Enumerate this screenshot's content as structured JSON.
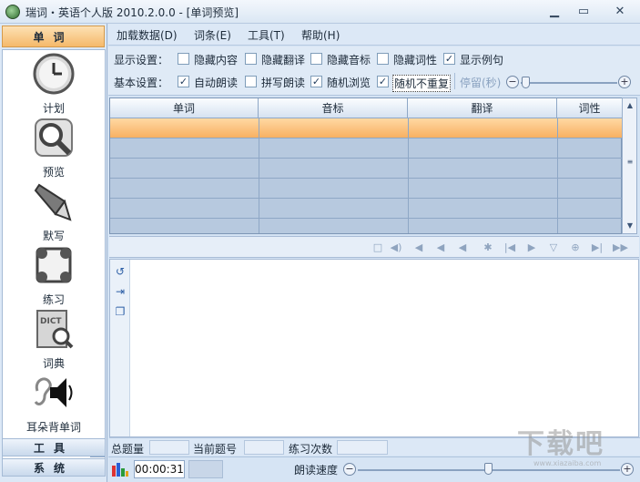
{
  "window": {
    "title": "瑞词・英语个人版 2010.2.0.0 - [单词预览]",
    "minimize": "▁",
    "restore": "▭",
    "close": "✕"
  },
  "sidebar": {
    "header": "单词",
    "items": [
      {
        "label": "计划",
        "icon": "clock-icon"
      },
      {
        "label": "预览",
        "icon": "magnifier-icon"
      },
      {
        "label": "默写",
        "icon": "pen-icon"
      },
      {
        "label": "练习",
        "icon": "exercise-icon"
      },
      {
        "label": "词典",
        "icon": "dictionary-icon"
      },
      {
        "label": "耳朵背单词",
        "icon": "speaker-icon"
      }
    ],
    "scroll_down": "▼",
    "footer_tools": "工具",
    "footer_system": "系统"
  },
  "menubar": [
    "加载数据(D)",
    "词条(E)",
    "工具(T)",
    "帮助(H)"
  ],
  "settings": {
    "display_label": "显示设置：",
    "display_options": [
      {
        "label": "隐藏内容",
        "checked": false
      },
      {
        "label": "隐藏翻译",
        "checked": false
      },
      {
        "label": "隐藏音标",
        "checked": false
      },
      {
        "label": "隐藏词性",
        "checked": false
      },
      {
        "label": "显示例句",
        "checked": true
      }
    ],
    "basic_label": "基本设置：",
    "basic_options": [
      {
        "label": "自动朗读",
        "checked": true
      },
      {
        "label": "拼写朗读",
        "checked": false
      },
      {
        "label": "随机浏览",
        "checked": true
      },
      {
        "label": "随机不重复",
        "checked": true
      }
    ],
    "stay_label": "停留(秒)",
    "minus": "−",
    "plus": "+"
  },
  "grid": {
    "columns": [
      "单词",
      "音标",
      "翻译",
      "词性"
    ],
    "rows": 5,
    "selected_row": 0
  },
  "player_icons": [
    "stop-icon",
    "play-sound-icon",
    "sound-low-icon",
    "sound-mid-icon",
    "sound-high-icon",
    "shuffle-icon",
    "first-icon",
    "play-icon",
    "flag-icon",
    "loop-icon",
    "last-icon",
    "forward-icon"
  ],
  "player_glyphs": [
    "□",
    "◀)",
    "◀",
    "◀",
    "◀",
    "✱",
    "|◀",
    "▶",
    "▽",
    "⊕",
    "▶|",
    "▶▶"
  ],
  "editor_tools": {
    "refresh": "↺",
    "next": "⇥",
    "copy": "❐"
  },
  "stats": {
    "total": "总题量",
    "current": "当前题号",
    "practice": "练习次数"
  },
  "status": {
    "clock": "00:00:31",
    "speed_label": "朗读速度",
    "minus": "−",
    "plus": "+"
  },
  "watermark": {
    "text": "下载吧",
    "url": "www.xiazaiba.com"
  }
}
